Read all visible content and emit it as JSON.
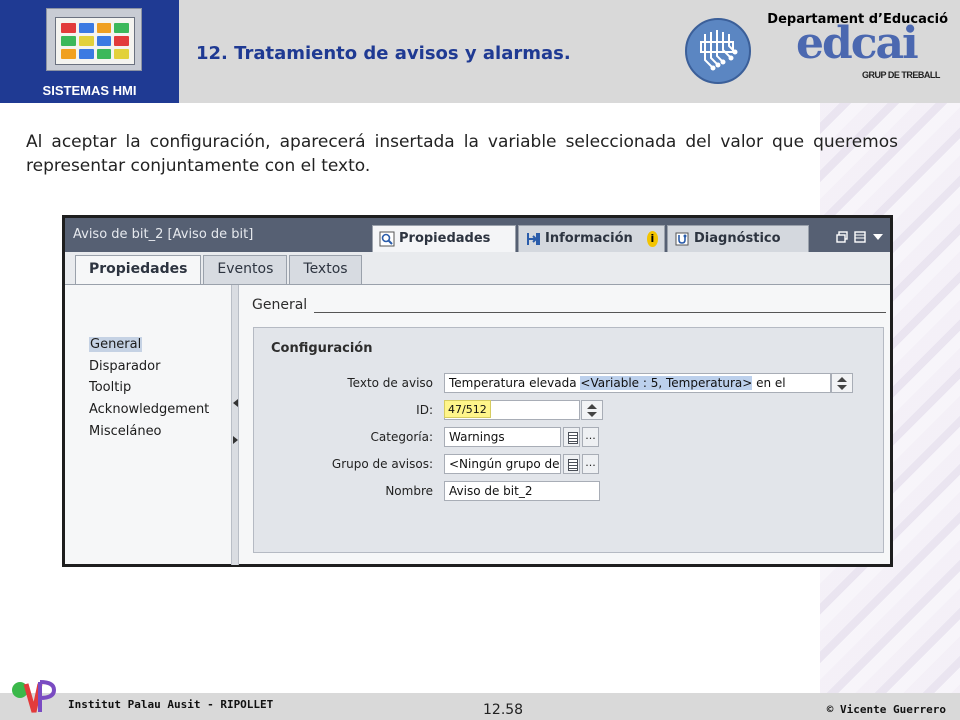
{
  "header": {
    "section_label": "SISTEMAS HMI",
    "title": "12. Tratamiento de avisos y alarmas.",
    "department": "Departament d’Educació",
    "logo_text": "edcai",
    "logo_subtext": "GRUP DE TREBALL",
    "brand_color": "#1f3a93"
  },
  "intro_text": "Al aceptar la configuración, aparecerá insertada la variable seleccionada del valor que queremos representar conjuntamente con el texto.",
  "screenshot": {
    "window_title": "Aviso de bit_2 [Aviso de bit]",
    "top_tabs": [
      {
        "label": "Propiedades",
        "icon": "properties-icon",
        "active": true
      },
      {
        "label": "Información",
        "icon": "info-icon",
        "badge": "i",
        "active": false
      },
      {
        "label": "Diagnóstico",
        "icon": "diagnostics-icon",
        "active": false
      }
    ],
    "sub_tabs": [
      {
        "label": "Propiedades",
        "active": true
      },
      {
        "label": "Eventos",
        "active": false
      },
      {
        "label": "Textos",
        "active": false
      }
    ],
    "nav_items": [
      {
        "label": "General",
        "selected": true
      },
      {
        "label": "Disparador",
        "selected": false
      },
      {
        "label": "Tooltip",
        "selected": false
      },
      {
        "label": "Acknowledgement",
        "selected": false
      },
      {
        "label": "Misceláneo",
        "selected": false
      }
    ],
    "section_header": "General",
    "config_title": "Configuración",
    "fields": {
      "texto_aviso": {
        "label": "Texto de aviso",
        "value_before": "Temperatura elevada ",
        "value_highlight": "<Variable : 5, Temperatura>",
        "value_after": " en el",
        "counter": "47/512"
      },
      "id": {
        "label": "ID:",
        "value": ""
      },
      "categoria": {
        "label": "Categoría:",
        "value": "Warnings"
      },
      "grupo": {
        "label": "Grupo de avisos:",
        "value": "<Ningún grupo de"
      },
      "nombre": {
        "label": "Nombre",
        "value": "Aviso de bit_2"
      }
    },
    "ellipsis_button": "..."
  },
  "footer": {
    "left": "Institut Palau Ausit - RIPOLLET",
    "center": "12.58",
    "right": "© Vicente Guerrero"
  }
}
